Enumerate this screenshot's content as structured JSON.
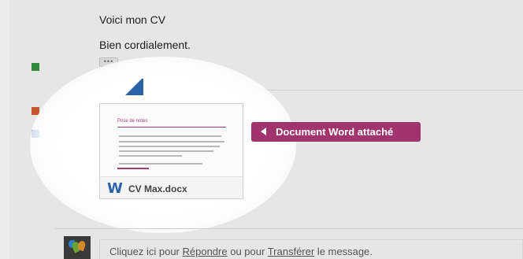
{
  "message": {
    "greeting": "Voici mon CV",
    "signoff": "Bien cordialement.",
    "more_label": "•••"
  },
  "attachment": {
    "preview_title": "Prise de notes",
    "file_name": "CV Max.docx",
    "icon_letter": "W"
  },
  "callout": {
    "label": "Document Word attaché",
    "color": "#a2346d"
  },
  "reply": {
    "prefix": "Cliquez ici pour ",
    "reply_link": "Répondre",
    "middle": " ou pour ",
    "forward_link": "Transférer",
    "suffix": " le message."
  },
  "colors": {
    "label_green": "#2f8a3a",
    "label_orange": "#c4582a",
    "label_blue": "#2b63a8"
  }
}
